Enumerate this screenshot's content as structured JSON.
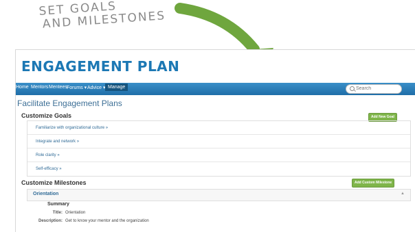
{
  "callout": {
    "line1": "SET GOALS",
    "line2": "AND MILESTONES"
  },
  "plan_title": "ENGAGEMENT PLAN",
  "nav": {
    "items": [
      "Home",
      "Mentors",
      "Mentees",
      "Forums ▾",
      "Advice ▾",
      "Manage"
    ],
    "active": "Manage",
    "search_placeholder": "Search"
  },
  "page_heading": "Facilitate Engagement Plans",
  "goals": {
    "title": "Customize Goals",
    "add_button": "Add New Goal",
    "items": [
      "Familiarize with organizational culture »",
      "Integrate and network »",
      "Role clarity »",
      "Self-efficacy »"
    ]
  },
  "milestones": {
    "title": "Customize Milestones",
    "add_button": "Add Custom Milestone",
    "current": "Orientation",
    "caret": "▲",
    "summary_label": "Summary",
    "title_label": "Title:",
    "title_value": "Orientation",
    "description_label": "Description:",
    "description_value": "Get to know your mentor and the organization"
  },
  "colors": {
    "accent": "#1c78b4",
    "nav": "#2a7dba",
    "button": "#7fb54a",
    "arrow": "#6fa63e"
  }
}
